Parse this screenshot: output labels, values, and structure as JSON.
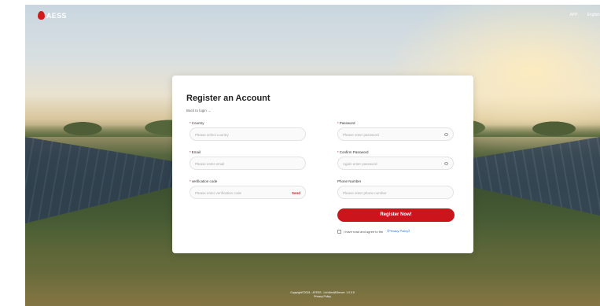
{
  "brand": {
    "logo_text": "AESS"
  },
  "topnav": {
    "app": "APP",
    "language": "English"
  },
  "form": {
    "title": "Register an Account",
    "back_link": "Back to login →",
    "required_mark": "*",
    "fields": {
      "country": {
        "label": "Country",
        "placeholder": "Please select country"
      },
      "email": {
        "label": "Email",
        "placeholder": "Please enter email"
      },
      "verification": {
        "label": "verification code",
        "placeholder": "Please enter verification code",
        "send": "Send"
      },
      "password": {
        "label": "Password",
        "placeholder": "Please enter password"
      },
      "confirm_password": {
        "label": "Confirm Password",
        "placeholder": "Again enter password"
      },
      "phone": {
        "label": "Phone Number",
        "placeholder": "Please enter phone number"
      }
    },
    "register_button": "Register Now!",
    "agreement_text": "I have read and agree to the",
    "privacy_link": "《Privacy Policy》"
  },
  "footer": {
    "copyright": "Copyright©2024 - ATESS . Ltd  Alesll&Server: 1.0.0.5",
    "privacy": "Privacy Policy"
  },
  "colors": {
    "accent": "#cc141c",
    "link": "#1f6fd6"
  }
}
